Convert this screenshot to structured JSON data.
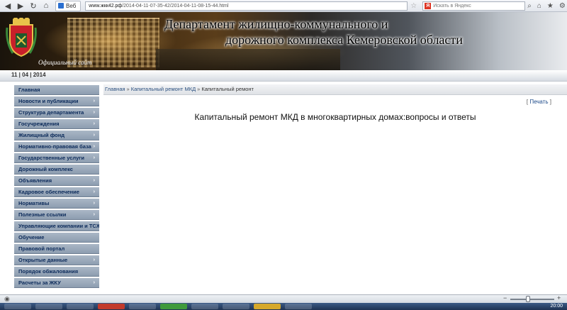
{
  "browser": {
    "tab_label": "Веб",
    "url_host": "www.жкк42.рф",
    "url_path": "/2014-04-11-07-35-42/2014-04-11-08-15-44.html",
    "search_placeholder": "Искать в Яндекс",
    "search_logo": "Я"
  },
  "header": {
    "title_line1": "Департамент жилищно-коммунального и",
    "title_line2": "дорожного комплекса Кемеровской области",
    "site_label": "Официальный сайт"
  },
  "date": "11 | 04 | 2014",
  "sidebar": {
    "items": [
      {
        "label": "Главная",
        "arrow": ""
      },
      {
        "label": "Новости и публикации",
        "arrow": "›"
      },
      {
        "label": "Структура департамента",
        "arrow": "›"
      },
      {
        "label": "Госучреждения",
        "arrow": "›"
      },
      {
        "label": "Жилищный фонд",
        "arrow": "›"
      },
      {
        "label": "Нормативно-правовая база",
        "arrow": "›"
      },
      {
        "label": "Государственные услуги",
        "arrow": "›"
      },
      {
        "label": "Дорожный комплекс",
        "arrow": ""
      },
      {
        "label": "Объявления",
        "arrow": "›"
      },
      {
        "label": "Кадровое обеспечение",
        "arrow": "›"
      },
      {
        "label": "Нормативы",
        "arrow": "›"
      },
      {
        "label": "Полезные ссылки",
        "arrow": "›"
      },
      {
        "label": "Управляющие компании и ТСЖ",
        "arrow": ""
      },
      {
        "label": "Обучение",
        "arrow": ""
      },
      {
        "label": "Правовой портал",
        "arrow": ""
      },
      {
        "label": "Открытые данные",
        "arrow": "›"
      },
      {
        "label": "Порядок обжалования",
        "arrow": ""
      },
      {
        "label": "Расчеты за ЖКУ",
        "arrow": "›"
      }
    ]
  },
  "breadcrumb": {
    "home": "Главная",
    "section": "Капитальный ремонт МКД",
    "current": "Капитальный ремонт",
    "separator": "»"
  },
  "print_label": "Печать",
  "content_title": "Капитальный ремонт МКД в многоквартирных домах:вопросы и ответы",
  "clock": "20:00"
}
